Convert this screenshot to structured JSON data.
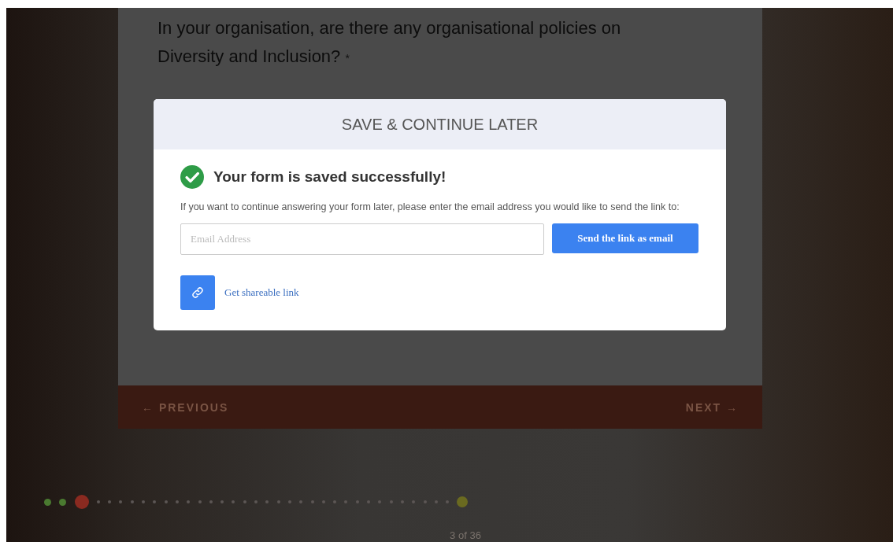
{
  "question": {
    "text": "In your organisation, are there any organisational policies on Diversity and Inclusion?",
    "required_mark": "*"
  },
  "navigation": {
    "previous": "← PREVIOUS",
    "next": "NEXT →"
  },
  "modal": {
    "title": "SAVE & CONTINUE LATER",
    "success_message": "Your form is saved successfully!",
    "instructions": "If you want to continue answering your form later, please enter the email address you would like to send the link to:",
    "email_field": {
      "placeholder": "Email Address"
    },
    "send_button": "Send the link as email",
    "share_link": "Get shareable link"
  },
  "progress": {
    "steps": [
      {
        "kind": "done"
      },
      {
        "kind": "done"
      },
      {
        "kind": "current"
      },
      {
        "kind": "todo"
      },
      {
        "kind": "todo"
      },
      {
        "kind": "todo"
      },
      {
        "kind": "todo"
      },
      {
        "kind": "todo"
      },
      {
        "kind": "todo"
      },
      {
        "kind": "todo"
      },
      {
        "kind": "todo"
      },
      {
        "kind": "todo"
      },
      {
        "kind": "todo"
      },
      {
        "kind": "todo"
      },
      {
        "kind": "todo"
      },
      {
        "kind": "todo"
      },
      {
        "kind": "todo"
      },
      {
        "kind": "todo"
      },
      {
        "kind": "todo"
      },
      {
        "kind": "todo"
      },
      {
        "kind": "todo"
      },
      {
        "kind": "todo"
      },
      {
        "kind": "todo"
      },
      {
        "kind": "todo"
      },
      {
        "kind": "todo"
      },
      {
        "kind": "todo"
      },
      {
        "kind": "todo"
      },
      {
        "kind": "todo"
      },
      {
        "kind": "todo"
      },
      {
        "kind": "todo"
      },
      {
        "kind": "todo"
      },
      {
        "kind": "todo"
      },
      {
        "kind": "todo"
      },
      {
        "kind": "todo"
      },
      {
        "kind": "todo"
      },
      {
        "kind": "end"
      }
    ],
    "counter": "3 of 36"
  }
}
